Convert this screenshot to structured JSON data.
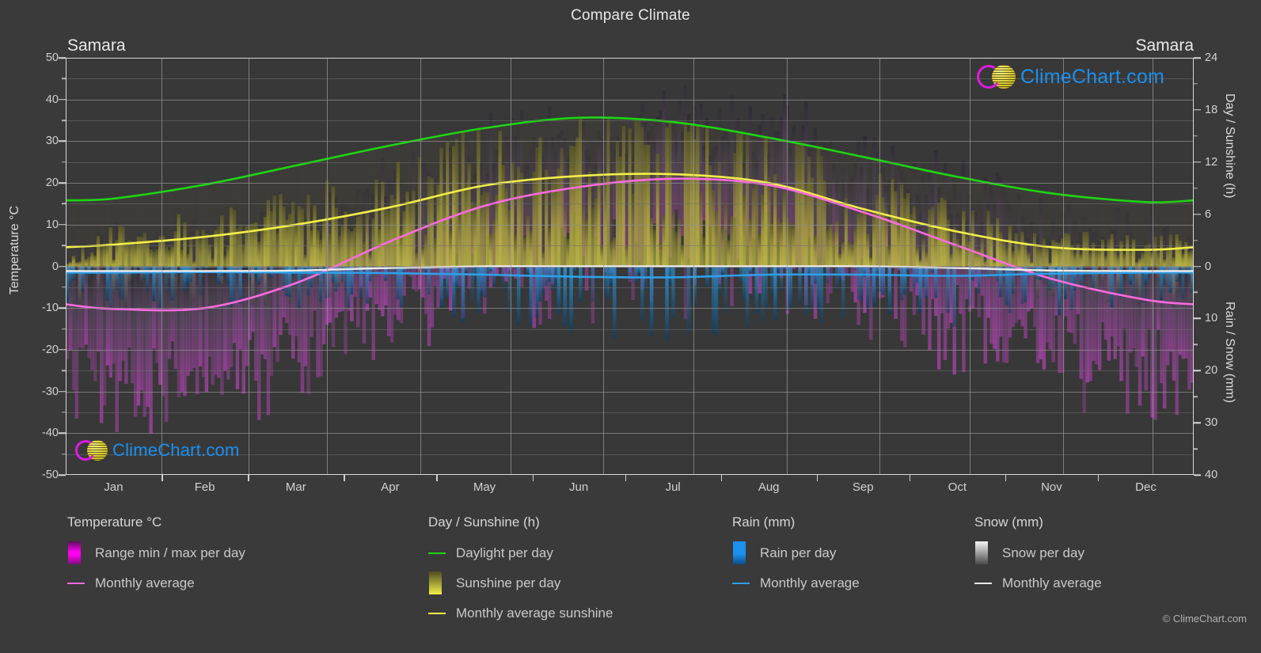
{
  "header": {
    "title": "Compare Climate",
    "location_left": "Samara",
    "location_right": "Samara"
  },
  "axes": {
    "left_title": "Temperature °C",
    "right_title_top": "Day / Sunshine (h)",
    "right_title_bottom": "Rain / Snow (mm)",
    "left_ticks": [
      "50",
      "40",
      "30",
      "20",
      "10",
      "0",
      "-10",
      "-20",
      "-30",
      "-40",
      "-50"
    ],
    "right_ticks_top": [
      "24",
      "18",
      "12",
      "6",
      "0"
    ],
    "right_ticks_bottom": [
      "10",
      "20",
      "30",
      "40"
    ],
    "x_ticks": [
      "Jan",
      "Feb",
      "Mar",
      "Apr",
      "May",
      "Jun",
      "Jul",
      "Aug",
      "Sep",
      "Oct",
      "Nov",
      "Dec"
    ]
  },
  "legend": {
    "groups": [
      {
        "title": "Temperature °C",
        "items": [
          {
            "label": "Range min / max per day",
            "key": "swatch",
            "color": "#ff00f0"
          },
          {
            "label": "Monthly average",
            "key": "line",
            "color": "#ff6ae0"
          }
        ]
      },
      {
        "title": "Day / Sunshine (h)",
        "items": [
          {
            "label": "Daylight per day",
            "key": "line",
            "color": "#1ed512"
          },
          {
            "label": "Sunshine per day",
            "key": "swatch",
            "color": "#f2ef49"
          },
          {
            "label": "Monthly average sunshine",
            "key": "line",
            "color": "#f2ef49"
          }
        ]
      },
      {
        "title": "Rain (mm)",
        "items": [
          {
            "label": "Rain per day",
            "key": "swatch",
            "color": "#1b90ef"
          },
          {
            "label": "Monthly average",
            "key": "line",
            "color": "#2f9fe8"
          }
        ]
      },
      {
        "title": "Snow (mm)",
        "items": [
          {
            "label": "Snow per day",
            "key": "swatch",
            "color": "#f2f2f2"
          },
          {
            "label": "Monthly average",
            "key": "line",
            "color": "#e8e8e8"
          }
        ]
      }
    ]
  },
  "watermark": {
    "text": "ClimeChart.com",
    "copyright": "© ClimeChart.com"
  },
  "colors": {
    "background": "#3a3a3a",
    "plot_background": "#383838",
    "grid": "#8e8e8e",
    "text": "#d2d2d2",
    "daylight": "#1ed512",
    "sunshine": "#f2ef49",
    "temp_avg": "#ff6ae0",
    "temp_range": "#ff00f0",
    "rain": "#1b90ef",
    "snow": "#f0f0f0"
  },
  "chart_data": {
    "type": "line",
    "title": "Compare Climate",
    "subtitle": "Samara",
    "xlabel": "",
    "ylabel": "Temperature °C",
    "categories": [
      "Jan",
      "Feb",
      "Mar",
      "Apr",
      "May",
      "Jun",
      "Jul",
      "Aug",
      "Sep",
      "Oct",
      "Nov",
      "Dec"
    ],
    "ylim": [
      -50,
      50
    ],
    "y2lim_day": [
      0,
      24
    ],
    "y2lim_precip": [
      0,
      40
    ],
    "grid": true,
    "legend_position": "below",
    "series": [
      {
        "name": "Daylight per day",
        "axis": "Day / Sunshine (h)",
        "unit": "h",
        "color": "#1ed512",
        "values": [
          7.8,
          9.4,
          11.6,
          13.9,
          15.9,
          17.1,
          16.6,
          14.8,
          12.6,
          10.3,
          8.4,
          7.4
        ]
      },
      {
        "name": "Monthly average sunshine",
        "axis": "Day / Sunshine (h)",
        "unit": "h",
        "color": "#f2ef49",
        "values": [
          2.5,
          3.4,
          4.8,
          6.8,
          9.3,
          10.4,
          10.6,
          9.6,
          6.6,
          4.0,
          2.2,
          1.9
        ]
      },
      {
        "name": "Monthly average temperature",
        "axis": "Temperature °C",
        "unit": "°C",
        "color": "#ff6ae0",
        "values": [
          -10.2,
          -10.0,
          -4.0,
          6.0,
          14.5,
          19.0,
          21.0,
          19.5,
          13.0,
          5.0,
          -3.0,
          -8.0
        ]
      },
      {
        "name": "Rain monthly average",
        "axis": "Rain / Snow (mm)",
        "unit": "mm",
        "color": "#2f9fe8",
        "values": [
          1.2,
          1.1,
          1.2,
          1.3,
          1.6,
          2.0,
          2.1,
          1.6,
          1.6,
          1.8,
          1.4,
          1.2
        ]
      },
      {
        "name": "Snow monthly average",
        "axis": "Rain / Snow (mm)",
        "unit": "mm",
        "color": "#e8e8e8",
        "values": [
          0.9,
          0.9,
          0.8,
          0.3,
          0.0,
          0.0,
          0.0,
          0.0,
          0.0,
          0.3,
          0.8,
          0.9
        ]
      }
    ]
  }
}
